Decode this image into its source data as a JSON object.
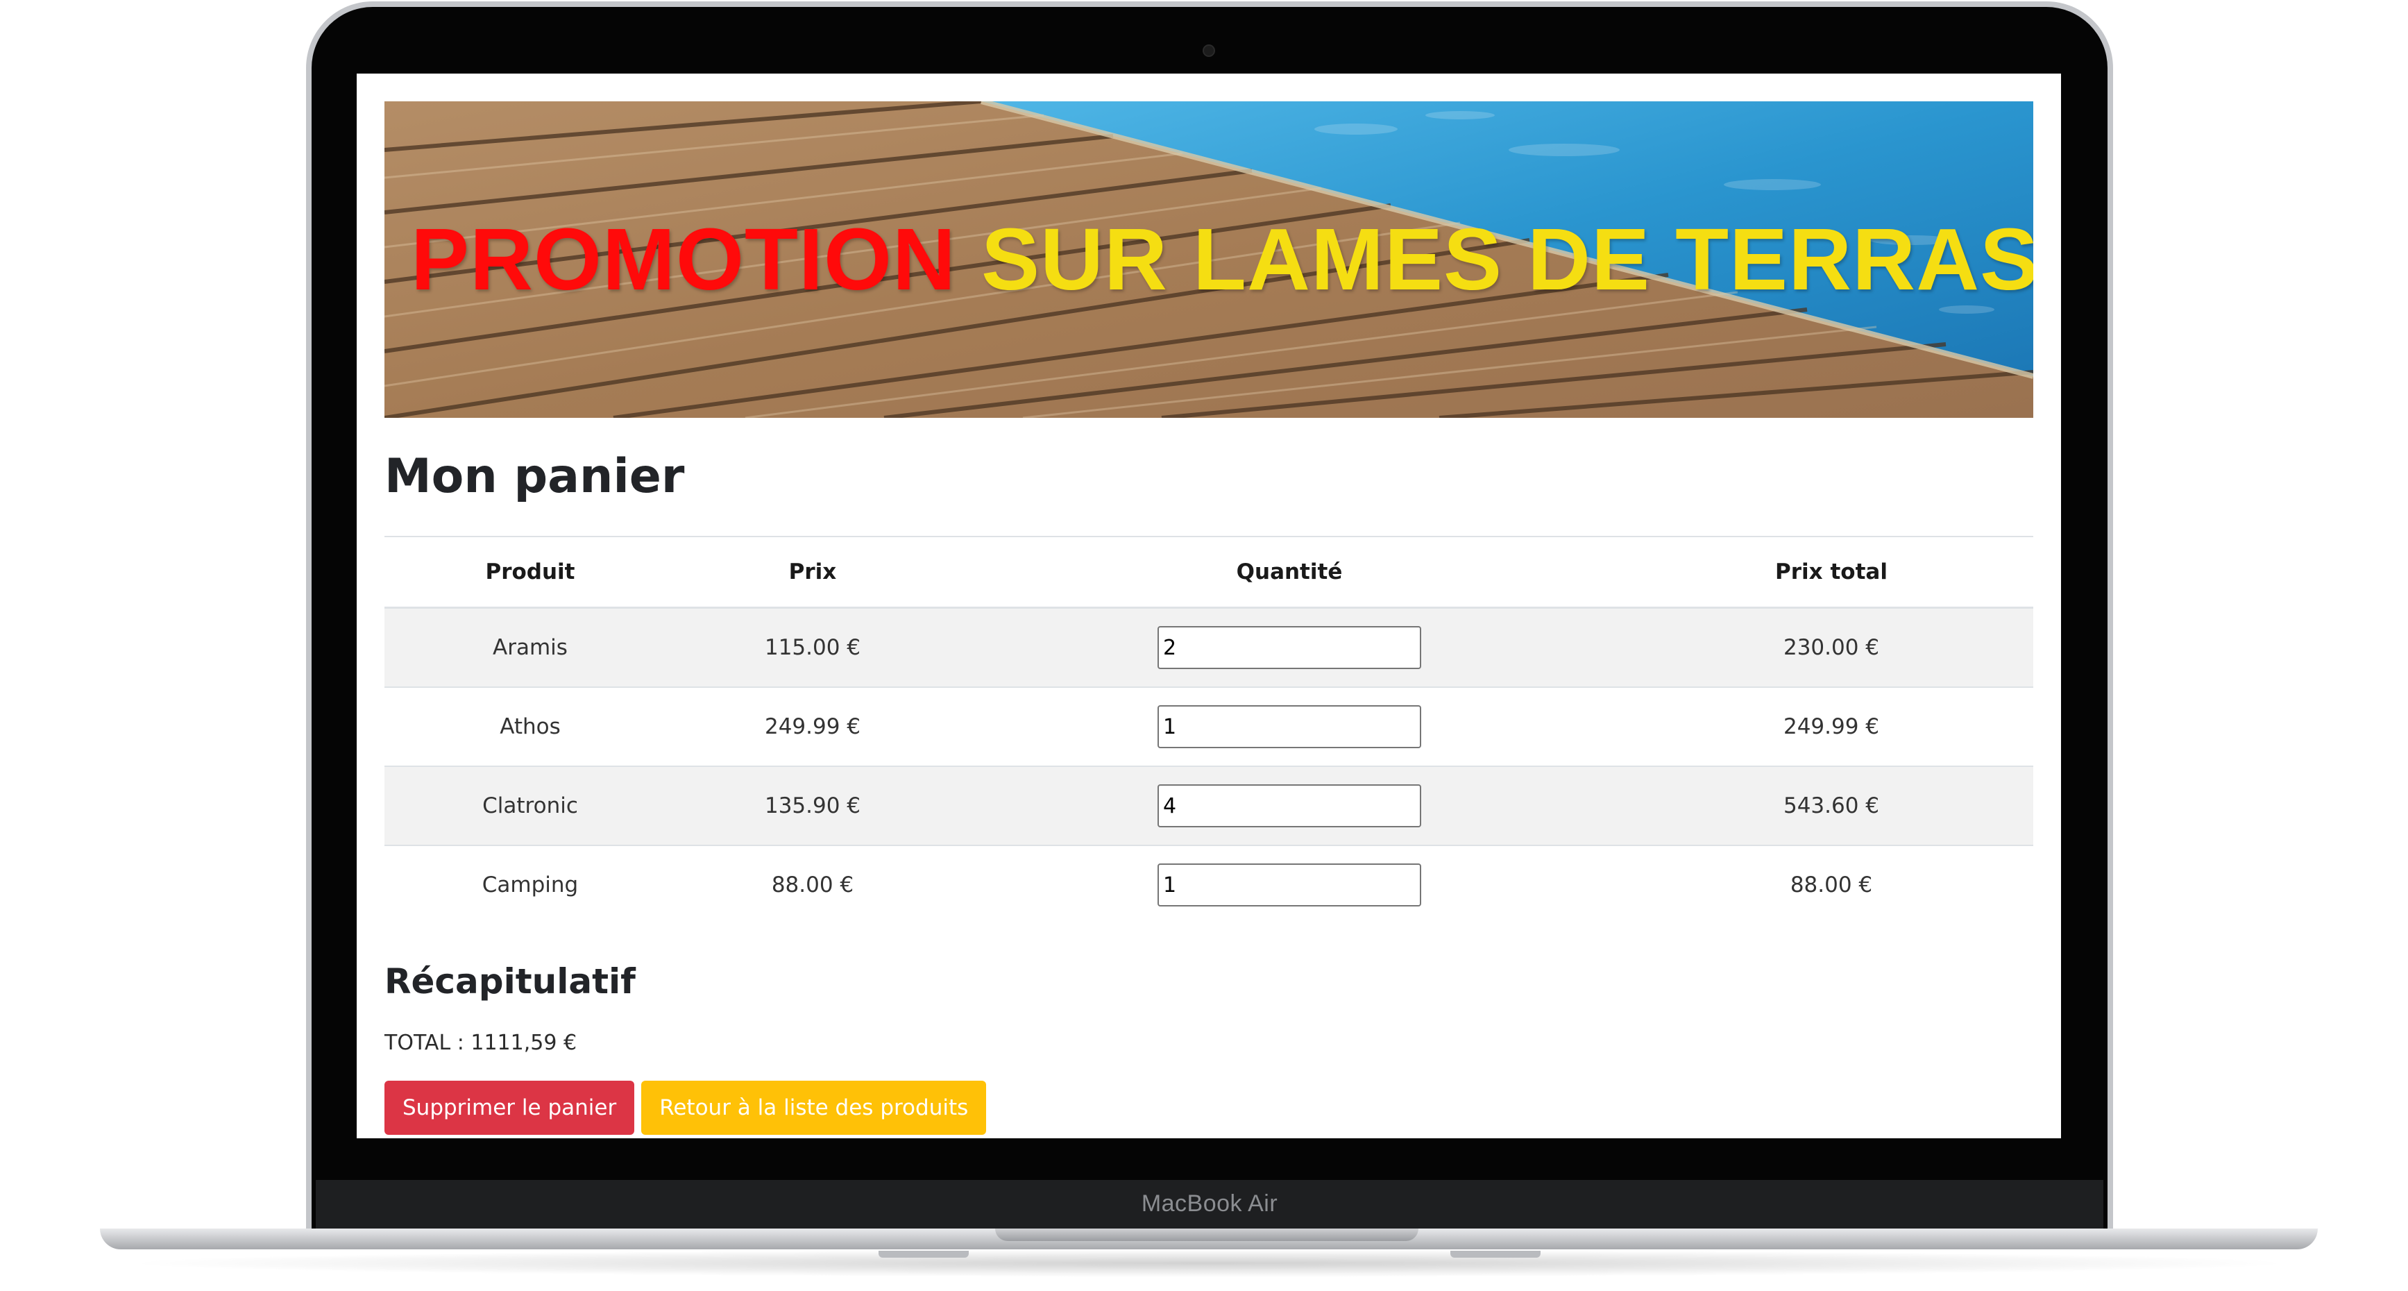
{
  "device": {
    "label": "MacBook Air"
  },
  "banner": {
    "title_part1": "PROMOTION",
    "title_part2": "SUR LAMES DE TERRASSE"
  },
  "page": {
    "title": "Mon panier"
  },
  "table": {
    "headers": {
      "product": "Produit",
      "price": "Prix",
      "quantity": "Quantité",
      "total": "Prix total"
    },
    "rows": [
      {
        "product": "Aramis",
        "price": "115.00 €",
        "quantity": "2",
        "total": "230.00 €"
      },
      {
        "product": "Athos",
        "price": "249.99 €",
        "quantity": "1",
        "total": "249.99 €"
      },
      {
        "product": "Clatronic",
        "price": "135.90 €",
        "quantity": "4",
        "total": "543.60 €"
      },
      {
        "product": "Camping",
        "price": "88.00 €",
        "quantity": "1",
        "total": "88.00 €"
      }
    ]
  },
  "summary": {
    "title": "Récapitulatif",
    "total_text": "TOTAL : 1111,59 €"
  },
  "buttons": {
    "clear_cart": "Supprimer le panier",
    "back_to_products": "Retour à la liste des produits"
  },
  "colors": {
    "danger": "#dc3545",
    "warning": "#ffc107",
    "promo_red": "#ff0a0a",
    "promo_yellow": "#f5de12"
  }
}
